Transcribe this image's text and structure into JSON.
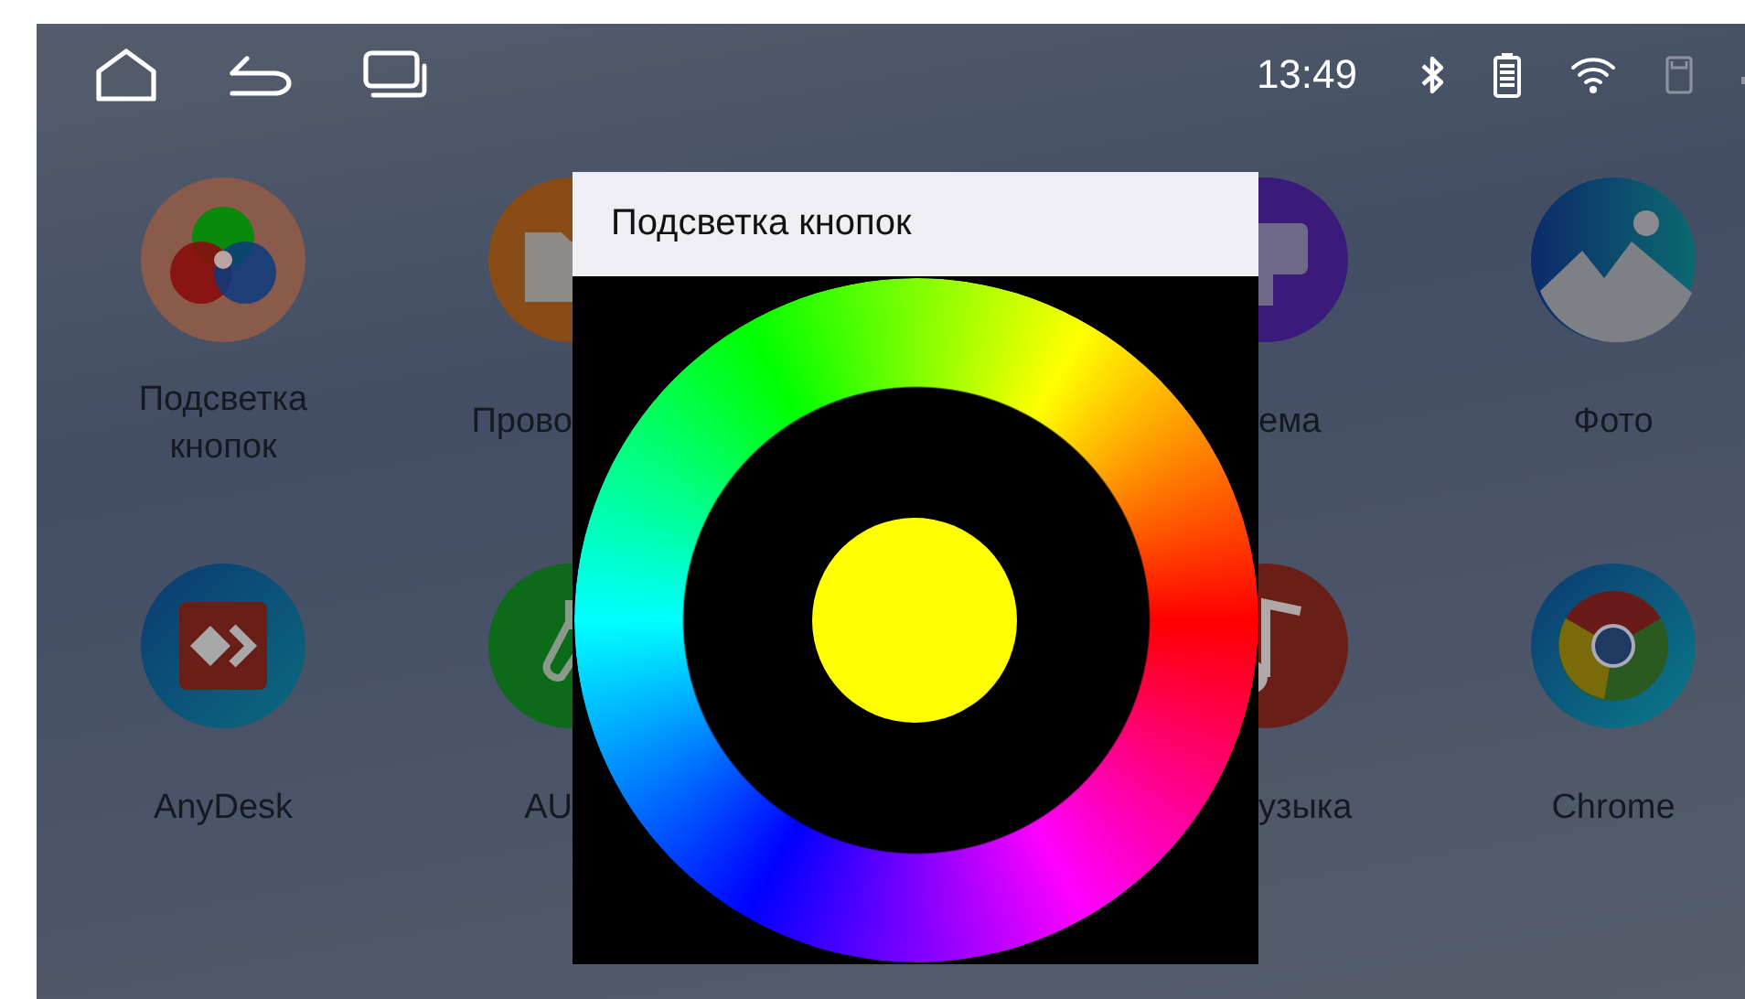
{
  "status_bar": {
    "time": "13:49"
  },
  "app_rows": [
    [
      {
        "label": "Подсветка кнопок",
        "kind": "full"
      },
      {
        "label": "Прово",
        "kind": "cut_right"
      },
      {
        "label": "ема",
        "kind": "cut_left"
      },
      {
        "label": "Фото",
        "kind": "full"
      }
    ],
    [
      {
        "label": "AnyDesk",
        "kind": "full"
      },
      {
        "label": "AU",
        "kind": "cut_right"
      },
      {
        "label": "узыка",
        "kind": "cut_left"
      },
      {
        "label": "Chrome",
        "kind": "full"
      }
    ]
  ],
  "dialog": {
    "title": "Подсветка кнопок"
  }
}
